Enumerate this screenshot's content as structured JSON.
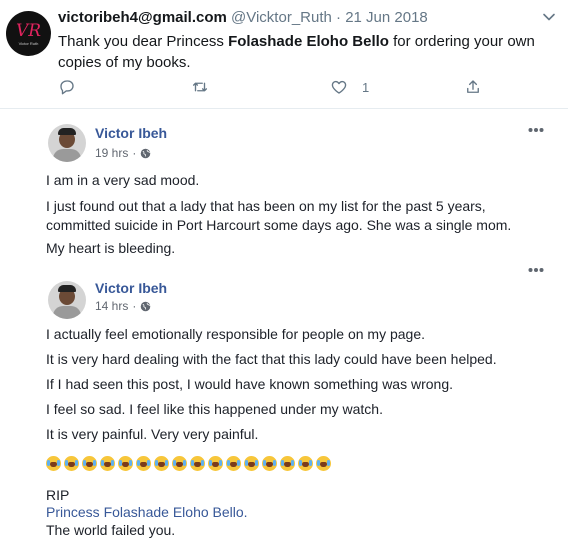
{
  "tweet": {
    "avatar_logo": "VR",
    "avatar_sub": "Victor Ruth",
    "name": "victoribeh4@gmail.com",
    "handle": "@Vicktor_Ruth",
    "separator": "·",
    "date": "21 Jun 2018",
    "text_before": "Thank you dear Princess ",
    "text_bold": "Folashade Eloho Bello",
    "text_after": " for ordering your own copies of my books.",
    "like_count": "1",
    "icons": [
      "caret-down-icon",
      "reply-icon",
      "retweet-icon",
      "like-icon",
      "share-icon"
    ]
  },
  "posts": [
    {
      "author": "Victor Ibeh",
      "time": "19 hrs",
      "privacy_icon": "globe-icon",
      "lines": [
        "I am in a very sad mood.",
        "I just found out that a lady that has been on my list for the past 5 years,",
        "committed suicide in Port Harcourt some days ago. She was a single mom.",
        "My heart is bleeding."
      ]
    },
    {
      "author": "Victor Ibeh",
      "time": "14 hrs",
      "privacy_icon": "globe-icon",
      "lines": [
        "I actually feel emotionally responsible for people on my page.",
        "It is very hard dealing with the fact that this lady could have been helped.",
        "If I had seen this post, I would have known something was wrong.",
        "I feel so sad. I feel like this happened under my watch.",
        "It is very painful. Very very painful."
      ],
      "emoji_count": 16,
      "emoji_name": "crying-face-emoji",
      "rip": "RIP",
      "rip_link": "Princess Folashade Eloho Bello.",
      "closing": "The world failed you."
    }
  ]
}
